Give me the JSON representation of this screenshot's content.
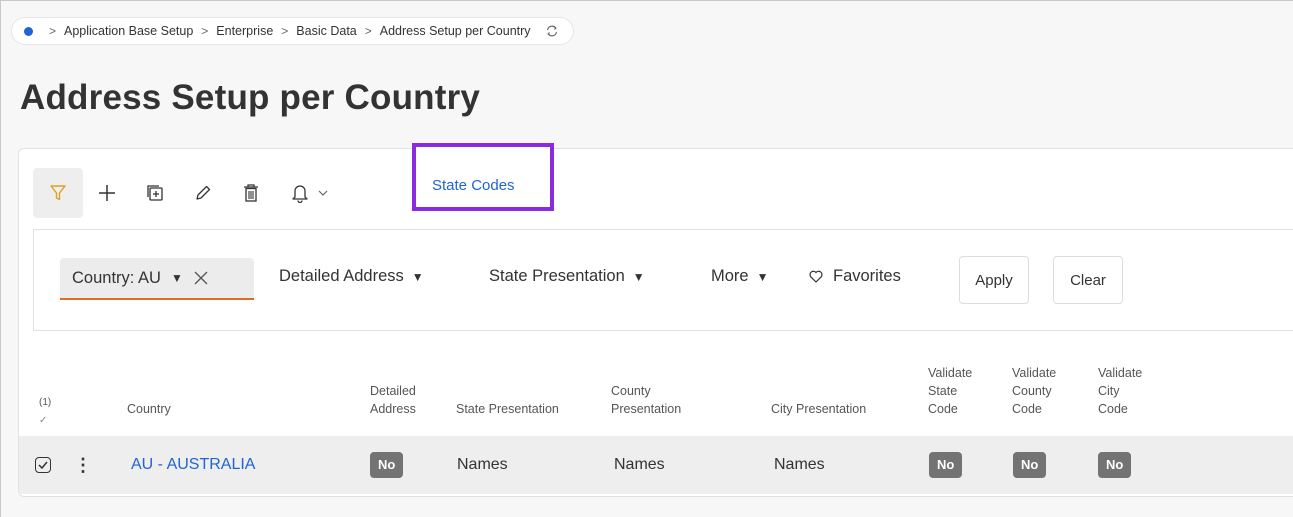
{
  "breadcrumb": {
    "items": [
      "Application Base Setup",
      "Enterprise",
      "Basic Data",
      "Address Setup per Country"
    ]
  },
  "page": {
    "title": "Address Setup per Country"
  },
  "toolbar": {
    "buttons": [
      "filter-icon",
      "add-icon",
      "duplicate-icon",
      "edit-icon",
      "delete-icon",
      "bell-icon"
    ],
    "state_codes_label": "State Codes",
    "highlight_color": "#8a2be2"
  },
  "filters": {
    "country_chip": "Country: AU",
    "items": [
      "Detailed Address",
      "State Presentation",
      "More",
      "Favorites"
    ],
    "apply_label": "Apply",
    "clear_label": "Clear"
  },
  "table": {
    "selected_count": "(1)",
    "headers": {
      "country": "Country",
      "detailed_address": [
        "Detailed",
        "Address"
      ],
      "state_presentation": "State Presentation",
      "county_presentation": [
        "County",
        "Presentation"
      ],
      "city_presentation": "City Presentation",
      "validate_state": [
        "Validate",
        "State",
        "Code"
      ],
      "validate_county": [
        "Validate",
        "County",
        "Code"
      ],
      "validate_city": [
        "Validate",
        "City",
        "Code"
      ]
    },
    "rows": [
      {
        "country": "AU - AUSTRALIA",
        "detailed_address": "No",
        "state_presentation": "Names",
        "county_presentation": "Names",
        "city_presentation": "Names",
        "validate_state": "No",
        "validate_county": "No",
        "validate_city": "No"
      }
    ]
  },
  "colors": {
    "accent": "#1f63d6",
    "filter_underline": "#e36b1d",
    "badge": "#737373"
  }
}
